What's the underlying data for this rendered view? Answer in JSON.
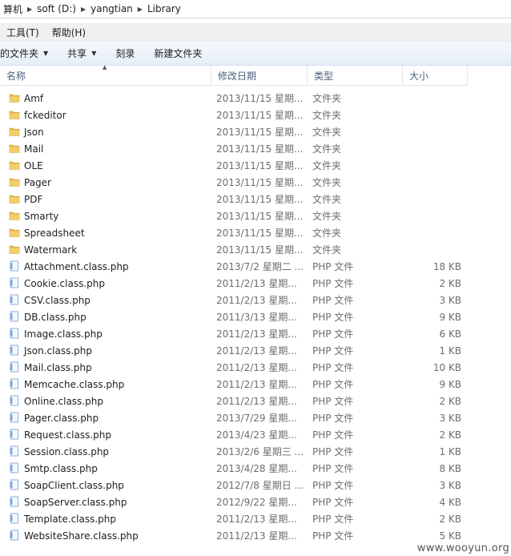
{
  "address": {
    "segments": [
      "算机",
      "soft (D:)",
      "yangtian",
      "Library"
    ]
  },
  "menu": {
    "items": [
      "工具(T)",
      "帮助(H)"
    ]
  },
  "toolbar": {
    "items": [
      "的文件夹",
      "共享",
      "刻录",
      "新建文件夹"
    ]
  },
  "columns": {
    "name": "名称",
    "date": "修改日期",
    "type": "类型",
    "size": "大小"
  },
  "files": [
    {
      "name": "Amf",
      "date": "2013/11/15 星期...",
      "type": "文件夹",
      "size": "",
      "kind": "folder"
    },
    {
      "name": "fckeditor",
      "date": "2013/11/15 星期...",
      "type": "文件夹",
      "size": "",
      "kind": "folder"
    },
    {
      "name": "Json",
      "date": "2013/11/15 星期...",
      "type": "文件夹",
      "size": "",
      "kind": "folder"
    },
    {
      "name": "Mail",
      "date": "2013/11/15 星期...",
      "type": "文件夹",
      "size": "",
      "kind": "folder"
    },
    {
      "name": "OLE",
      "date": "2013/11/15 星期...",
      "type": "文件夹",
      "size": "",
      "kind": "folder"
    },
    {
      "name": "Pager",
      "date": "2013/11/15 星期...",
      "type": "文件夹",
      "size": "",
      "kind": "folder"
    },
    {
      "name": "PDF",
      "date": "2013/11/15 星期...",
      "type": "文件夹",
      "size": "",
      "kind": "folder"
    },
    {
      "name": "Smarty",
      "date": "2013/11/15 星期...",
      "type": "文件夹",
      "size": "",
      "kind": "folder"
    },
    {
      "name": "Spreadsheet",
      "date": "2013/11/15 星期...",
      "type": "文件夹",
      "size": "",
      "kind": "folder"
    },
    {
      "name": "Watermark",
      "date": "2013/11/15 星期...",
      "type": "文件夹",
      "size": "",
      "kind": "folder"
    },
    {
      "name": "Attachment.class.php",
      "date": "2013/7/2 星期二 ...",
      "type": "PHP 文件",
      "size": "18 KB",
      "kind": "file"
    },
    {
      "name": "Cookie.class.php",
      "date": "2011/2/13 星期...",
      "type": "PHP 文件",
      "size": "2 KB",
      "kind": "file"
    },
    {
      "name": "CSV.class.php",
      "date": "2011/2/13 星期...",
      "type": "PHP 文件",
      "size": "3 KB",
      "kind": "file"
    },
    {
      "name": "DB.class.php",
      "date": "2011/3/13 星期...",
      "type": "PHP 文件",
      "size": "9 KB",
      "kind": "file"
    },
    {
      "name": "Image.class.php",
      "date": "2011/2/13 星期...",
      "type": "PHP 文件",
      "size": "6 KB",
      "kind": "file"
    },
    {
      "name": "Json.class.php",
      "date": "2011/2/13 星期...",
      "type": "PHP 文件",
      "size": "1 KB",
      "kind": "file"
    },
    {
      "name": "Mail.class.php",
      "date": "2011/2/13 星期...",
      "type": "PHP 文件",
      "size": "10 KB",
      "kind": "file"
    },
    {
      "name": "Memcache.class.php",
      "date": "2011/2/13 星期...",
      "type": "PHP 文件",
      "size": "9 KB",
      "kind": "file"
    },
    {
      "name": "Online.class.php",
      "date": "2011/2/13 星期...",
      "type": "PHP 文件",
      "size": "2 KB",
      "kind": "file"
    },
    {
      "name": "Pager.class.php",
      "date": "2013/7/29 星期...",
      "type": "PHP 文件",
      "size": "3 KB",
      "kind": "file"
    },
    {
      "name": "Request.class.php",
      "date": "2013/4/23 星期...",
      "type": "PHP 文件",
      "size": "2 KB",
      "kind": "file"
    },
    {
      "name": "Session.class.php",
      "date": "2013/2/6 星期三 ...",
      "type": "PHP 文件",
      "size": "1 KB",
      "kind": "file"
    },
    {
      "name": "Smtp.class.php",
      "date": "2013/4/28 星期...",
      "type": "PHP 文件",
      "size": "8 KB",
      "kind": "file"
    },
    {
      "name": "SoapClient.class.php",
      "date": "2012/7/8 星期日 ...",
      "type": "PHP 文件",
      "size": "3 KB",
      "kind": "file"
    },
    {
      "name": "SoapServer.class.php",
      "date": "2012/9/22 星期...",
      "type": "PHP 文件",
      "size": "4 KB",
      "kind": "file"
    },
    {
      "name": "Template.class.php",
      "date": "2011/2/13 星期...",
      "type": "PHP 文件",
      "size": "2 KB",
      "kind": "file"
    },
    {
      "name": "WebsiteShare.class.php",
      "date": "2011/2/13 星期...",
      "type": "PHP 文件",
      "size": "5 KB",
      "kind": "file"
    }
  ],
  "watermark": "www.wooyun.org",
  "colors": {
    "folder": "#e8b84a",
    "file": "#7fa7d6",
    "header_text": "#4c607a",
    "detail_text": "#6d6d6d"
  }
}
